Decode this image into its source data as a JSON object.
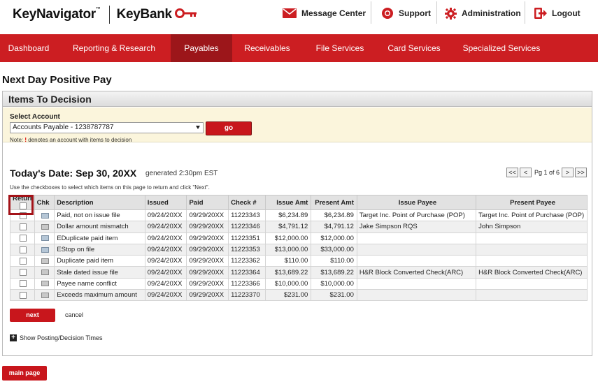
{
  "brand": {
    "name": "KeyNavigator",
    "tm": "™",
    "bank": "KeyBank"
  },
  "utility": [
    {
      "label": "Message Center",
      "icon": "envelope-icon"
    },
    {
      "label": "Support",
      "icon": "lifebuoy-icon"
    },
    {
      "label": "Administration",
      "icon": "gear-icon"
    },
    {
      "label": "Logout",
      "icon": "logout-icon"
    }
  ],
  "nav": [
    {
      "label": "Dashboard"
    },
    {
      "label": "Reporting & Research"
    },
    {
      "label": "Payables"
    },
    {
      "label": "Receivables"
    },
    {
      "label": "File Services"
    },
    {
      "label": "Card Services"
    },
    {
      "label": "Specialized Services"
    }
  ],
  "page": {
    "title": "Next Day Positive Pay",
    "panel_title": "Items To Decision"
  },
  "account": {
    "label": "Select Account",
    "selected": "Accounts Payable - 1238787787",
    "go_label": "go",
    "note_prefix": "Note: ",
    "note_bang": "!",
    "note_suffix": " denotes an account with items to decision"
  },
  "status": {
    "today": "Today's Date: Sep 30, 20XX",
    "generated": "generated 2:30pm EST",
    "page_indicator": "Pg 1 of 6",
    "instructions": "Use the checkboxes to select which items on this page to return and click \"Next\"."
  },
  "pager": {
    "first": "<<",
    "prev": "<",
    "next": ">",
    "last": ">>"
  },
  "table": {
    "headers": [
      "Return",
      "Chk",
      "Description",
      "Issued",
      "Paid",
      "Check #",
      "Issue Amt",
      "Present Amt",
      "Issue Payee",
      "Present Payee"
    ],
    "rows": [
      [
        "Paid, not on issue file",
        "09/24/20XX",
        "09/29/20XX",
        "11223343",
        "$6,234.89",
        "$6,234.89",
        "Target Inc. Point of Purchase (POP)",
        "Target Inc. Point of Purchase (POP)"
      ],
      [
        "Dollar amount mismatch",
        "09/24/20XX",
        "09/29/20XX",
        "11223346",
        "$4,791.12",
        "$4,791.12",
        "Jake Simpson RQS",
        "John Simpson"
      ],
      [
        "EDuplicate paid item",
        "09/24/20XX",
        "09/29/20XX",
        "11223351",
        "$12,000.00",
        "$12,000.00",
        "",
        ""
      ],
      [
        "EStop on file",
        "09/24/20XX",
        "09/29/20XX",
        "11223353",
        "$13,000.00",
        "$33,000.00",
        "",
        ""
      ],
      [
        "Duplicate paid item",
        "09/24/20XX",
        "09/29/20XX",
        "11223362",
        "$110.00",
        "$110.00",
        "",
        ""
      ],
      [
        "Stale dated issue file",
        "09/24/20XX",
        "09/29/20XX",
        "11223364",
        "$13,689.22",
        "$13,689.22",
        "H&R Block Converted Check(ARC)",
        "H&R Block Converted Check(ARC)"
      ],
      [
        "Payee name conflict",
        "09/24/20XX",
        "09/29/20XX",
        "11223366",
        "$10,000.00",
        "$10,000.00",
        "",
        ""
      ],
      [
        "Exceeds maximum amount",
        "09/24/20XX",
        "09/29/20XX",
        "11223370",
        "$231.00",
        "$231.00",
        "",
        ""
      ]
    ]
  },
  "actions": {
    "next": "next",
    "cancel": "cancel",
    "show_posting": "Show Posting/Decision Times",
    "main_page": "main page"
  },
  "colors": {
    "brand_red": "#cc1e22",
    "active_nav": "#9c161a",
    "account_bg": "#fbf5dc"
  }
}
